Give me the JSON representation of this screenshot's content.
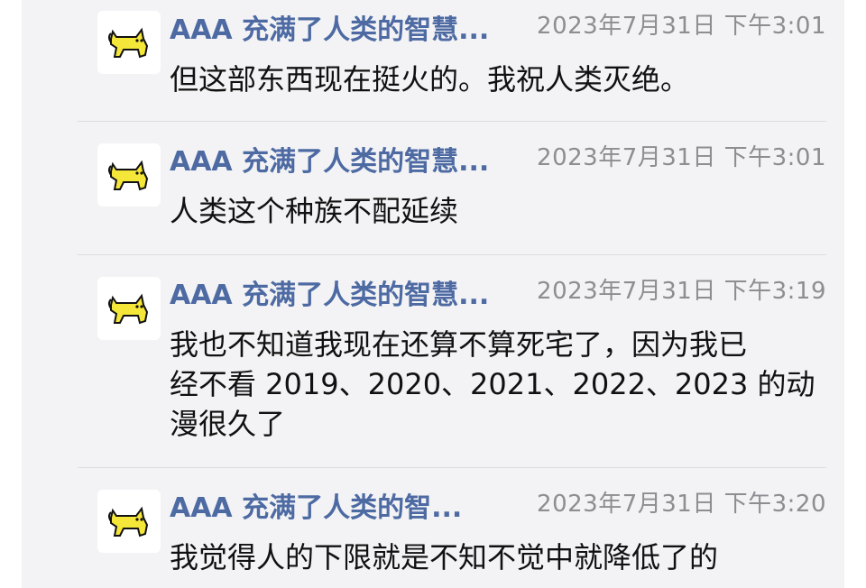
{
  "messages": [
    {
      "sender": "AAA 充满了人类的智慧...",
      "time": "2023年7月31日 下午3:01",
      "text": "但这部东西现在挺火的。我祝人类灭绝。"
    },
    {
      "sender": "AAA 充满了人类的智慧...",
      "time": "2023年7月31日 下午3:01",
      "text": "人类这个种族不配延续"
    },
    {
      "sender": "AAA 充满了人类的智慧...",
      "time": "2023年7月31日 下午3:19",
      "text_lines": [
        "我也不知道我现在还算不算死宅了，因为我已",
        "经不看 2019、2020、2021、2022、2023 的动",
        "漫很久了"
      ]
    },
    {
      "sender": "AAA 充满了人类的智...",
      "time": "2023年7月31日 下午3:20",
      "text": "我觉得人的下限就是不知不觉中就降低了的"
    }
  ],
  "icons": {
    "avatar": "yellow-cat-icon"
  },
  "colors": {
    "sender": "#4d6aa3",
    "time": "#8d8d92",
    "text": "#111111",
    "panel_bg": "#f3f3f5",
    "avatar_cat": "#f5e63a"
  }
}
